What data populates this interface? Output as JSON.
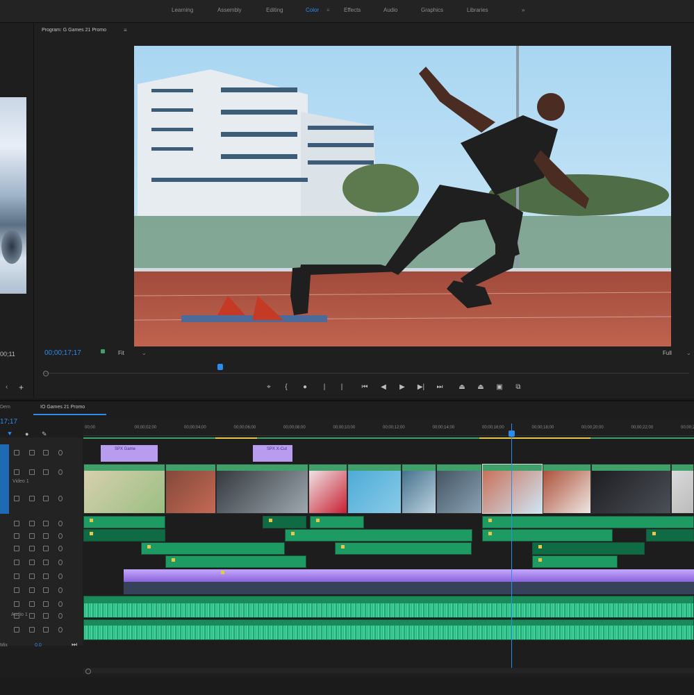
{
  "workspace_tabs": [
    {
      "label": "Learning"
    },
    {
      "label": "Assembly"
    },
    {
      "label": "Editing"
    },
    {
      "label": "Color"
    },
    {
      "label": "Effects"
    },
    {
      "label": "Audio"
    },
    {
      "label": "Graphics"
    },
    {
      "label": "Libraries"
    }
  ],
  "workspace_more": "»",
  "source_timecode": "00;11",
  "program": {
    "tab_label": "Program: G Games 21 Promo",
    "timecode": "00;00;17;17",
    "fit_label": "Fit",
    "fraction_label": "Full",
    "playhead_fraction": 0.27
  },
  "timeline": {
    "left_tab": "Dem",
    "tab_label": "IO Games 21 Promo",
    "timecode": "17;17",
    "track_names": {
      "video": "Video 1",
      "audio": "Audio 1",
      "mix": "Mix"
    },
    "ruler_ticks": [
      "00;00",
      "00;00;02;00",
      "00;00;04;00",
      "00;00;06;00",
      "00;00;08;00",
      "00;00;10;00",
      "00;00;12;00",
      "00;00;14;00",
      "00;00;16;00",
      "00;00;18;00",
      "00;00;20;00",
      "00;00;22;00",
      "00;00;24;00"
    ],
    "title_clips": [
      "SPX Game",
      "SPX X-Cut"
    ],
    "mix_value": "0.0"
  },
  "colors": {
    "accent": "#2d8ceb",
    "video_clip": "#3fa06a",
    "audio_clip": "#1e9a63",
    "title_clip": "#b89cf0"
  }
}
